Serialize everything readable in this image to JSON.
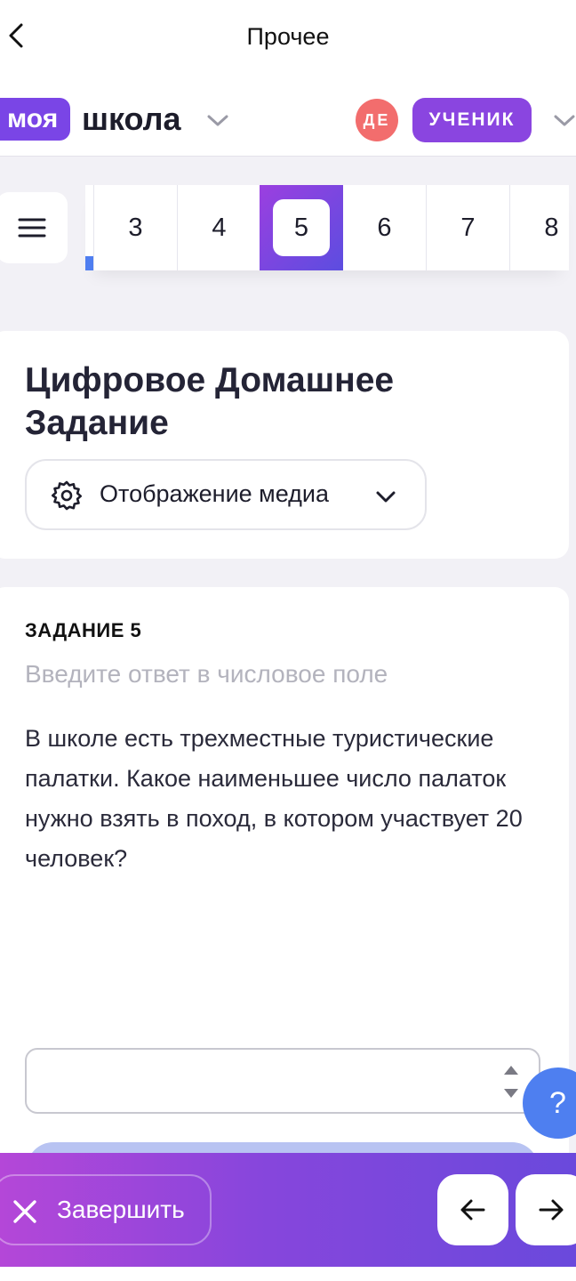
{
  "header": {
    "title": "Прочее"
  },
  "brand": {
    "part1": "моя",
    "part2": "школа"
  },
  "user": {
    "initials": "ДЕ",
    "role": "УЧЕНИК",
    "initials_color": "#f26d6d",
    "role_color": "#8a45e0"
  },
  "task_nav": {
    "tabs": [
      "3",
      "4",
      "5",
      "6",
      "7",
      "8"
    ],
    "active": "5"
  },
  "panel": {
    "title": "Цифровое Домашнее Задание",
    "media_button": "Отображение медиа"
  },
  "task": {
    "label": "ЗАДАНИЕ 5",
    "hint": "Введите ответ в числовое поле",
    "text": "В школе есть трехместные туристические палатки. Какое наименьшее число палаток нужно взять в поход, в котором участвует 20 человек?",
    "answer_value": ""
  },
  "help": {
    "label": "?"
  },
  "footer": {
    "finish_label": "Завершить"
  },
  "colors": {
    "accent": "#7a45e6",
    "help": "#4e7ff0"
  }
}
